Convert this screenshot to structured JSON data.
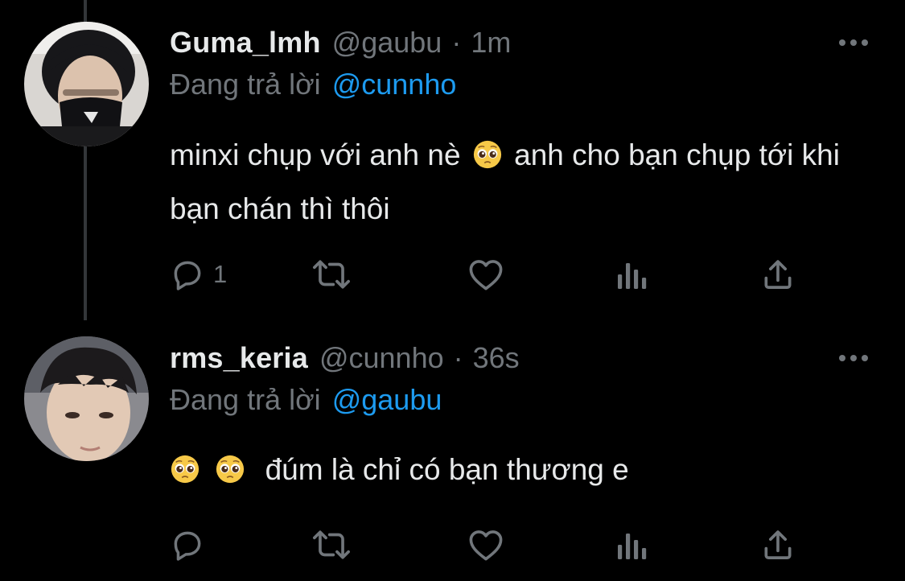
{
  "tweets": [
    {
      "display_name": "Guma_lmh",
      "handle": "@gaubu",
      "separator": "·",
      "time": "1m",
      "reply_prefix": "Đang trả lời",
      "reply_to": "@cunnho",
      "body_part1": "minxi chụp với anh nè",
      "body_part2": "anh cho bạn chụp tới khi bạn chán thì thôi",
      "actions": {
        "reply_count": "1",
        "retweet_count": "",
        "like_count": ""
      }
    },
    {
      "display_name": "rms_keria",
      "handle": "@cunnho",
      "separator": "·",
      "time": "36s",
      "reply_prefix": "Đang trả lời",
      "reply_to": "@gaubu",
      "body_text": "đúm là chỉ có bạn thương e",
      "actions": {
        "reply_count": "",
        "retweet_count": "",
        "like_count": ""
      }
    }
  ],
  "icons": {
    "reply": "reply-icon",
    "retweet": "retweet-icon",
    "like": "heart-icon",
    "views": "views-icon",
    "share": "share-icon",
    "more": "more-icon",
    "emoji": "pleading-face-emoji"
  },
  "colors": {
    "background": "#000000",
    "text": "#e7e9ea",
    "secondary": "#71767b",
    "mention": "#1d9bf0",
    "thread_line": "#333639"
  }
}
